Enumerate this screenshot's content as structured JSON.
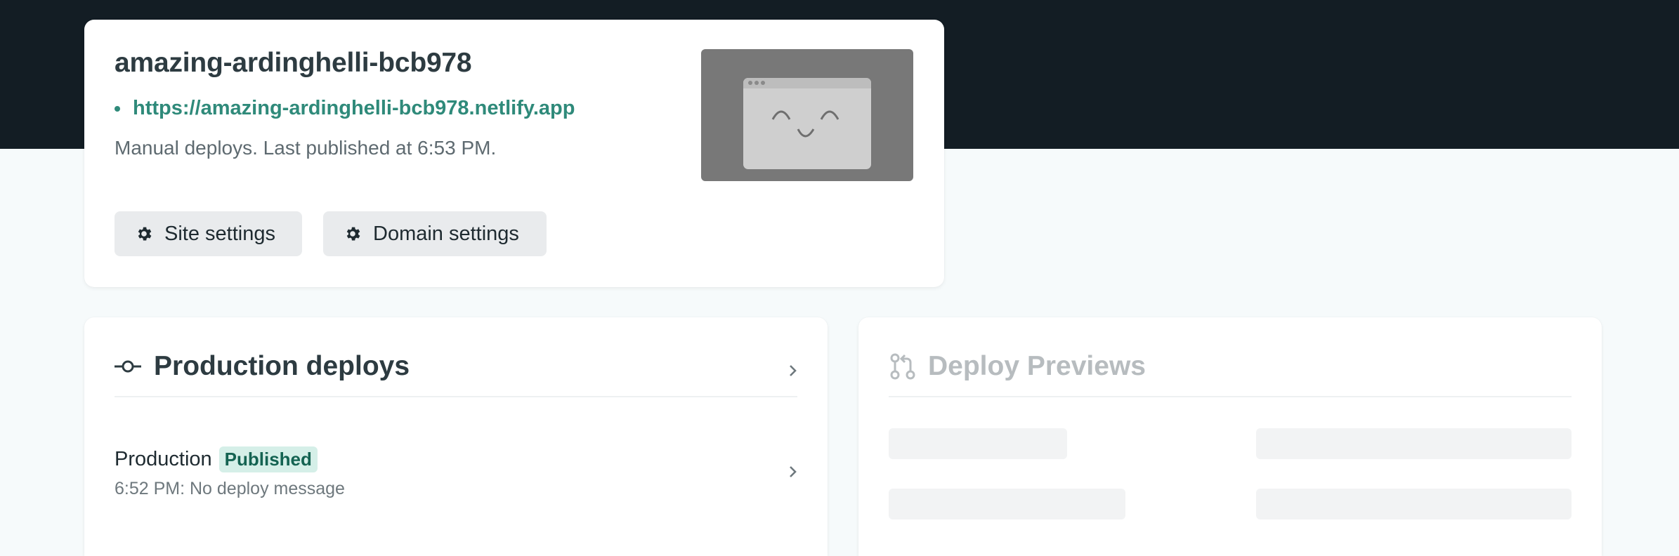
{
  "site": {
    "name": "amazing-ardinghelli-bcb978",
    "url": "https://amazing-ardinghelli-bcb978.netlify.app",
    "status": "Manual deploys. Last published at 6:53 PM.",
    "buttons": {
      "site_settings": "Site settings",
      "domain_settings": "Domain settings"
    },
    "thumbnail_icon": "smiling-browser-icon"
  },
  "production": {
    "title": "Production deploys",
    "icon": "commit-icon",
    "latest": {
      "label": "Production",
      "badge": "Published",
      "message": "6:52 PM: No deploy message"
    }
  },
  "previews": {
    "title": "Deploy Previews",
    "icon": "git-pull-request-icon"
  },
  "colors": {
    "header_bg": "#131d24",
    "page_bg": "#f6fafb",
    "link": "#2f8a7a",
    "badge_bg": "#d5efe8",
    "badge_text": "#146352"
  }
}
